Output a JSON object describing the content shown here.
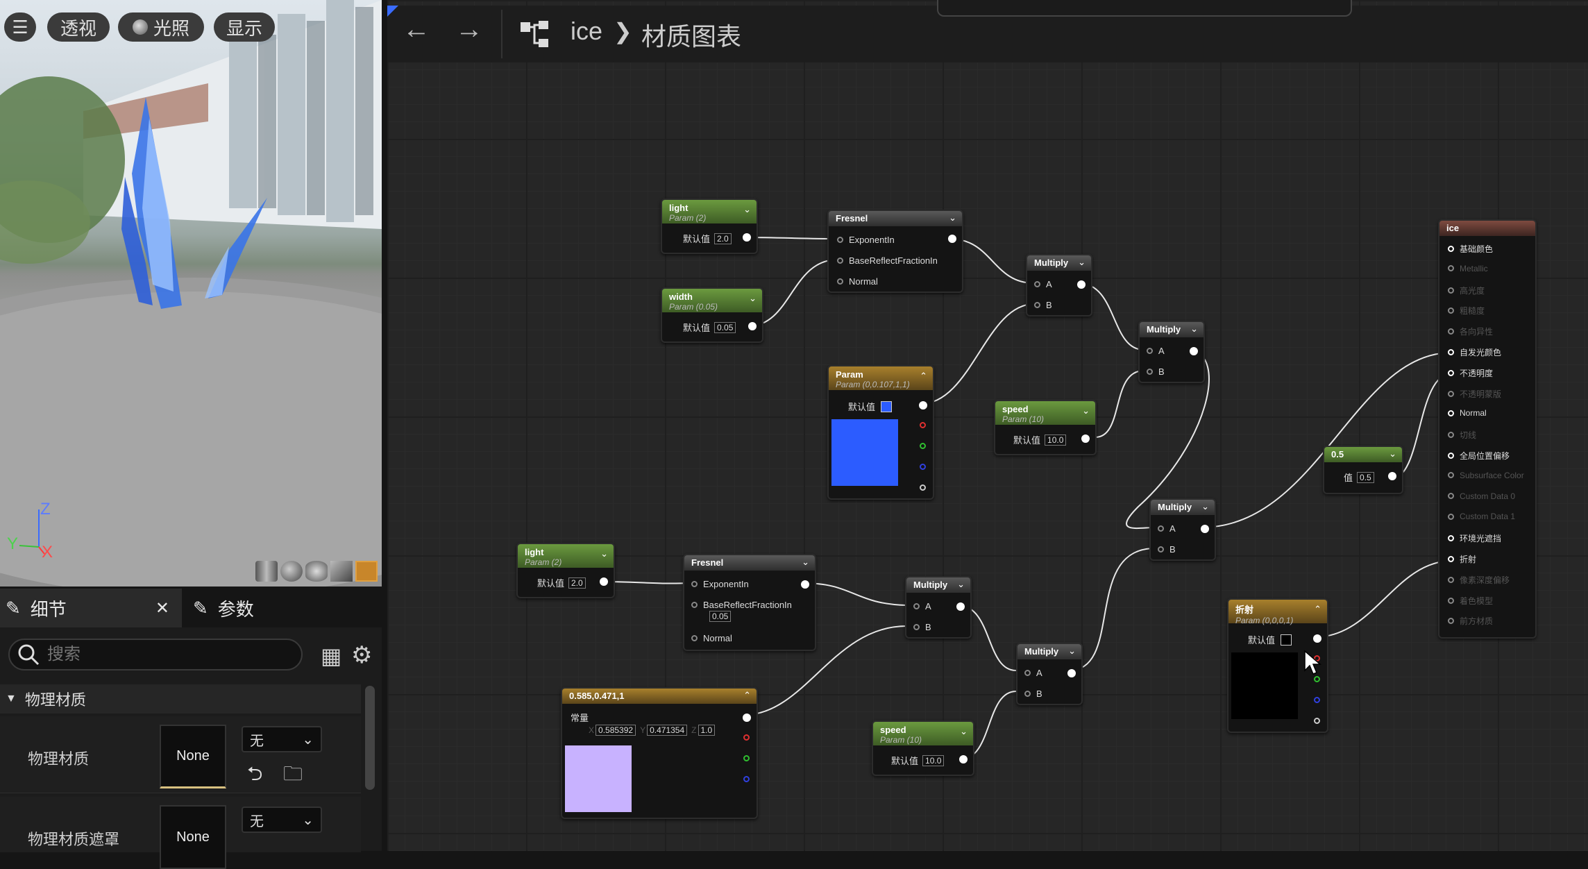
{
  "viewport": {
    "buttons": [
      "透视",
      "光照",
      "显示"
    ],
    "axes": {
      "z": "Z",
      "y": "Y",
      "x": "X"
    }
  },
  "toolbar": {
    "breadcrumb_asset": "ice",
    "breadcrumb_graph": "材质图表"
  },
  "panel": {
    "tab_details": "细节",
    "tab_params": "参数",
    "search_placeholder": "搜索",
    "section_title": "物理材质",
    "props": [
      {
        "label": "物理材质",
        "value": "None",
        "dropdown": "无"
      },
      {
        "label": "物理材质遮罩",
        "value": "None",
        "dropdown": "无"
      }
    ]
  },
  "nodes": {
    "light1": {
      "title": "light",
      "sub": "Param (2)",
      "label": "默认值",
      "value": "2.0"
    },
    "width": {
      "title": "width",
      "sub": "Param (0.05)",
      "label": "默认值",
      "value": "0.05"
    },
    "fresnel1": {
      "title": "Fresnel",
      "pins": [
        "ExponentIn",
        "BaseReflectFractionIn",
        "Normal"
      ]
    },
    "param_color": {
      "title": "Param",
      "sub": "Param (0,0.107,1,1)",
      "label": "默认值"
    },
    "multiply1": {
      "title": "Multiply",
      "a": "A",
      "b": "B"
    },
    "speed1": {
      "title": "speed",
      "sub": "Param (10)",
      "label": "默认值",
      "value": "10.0"
    },
    "multiply2": {
      "title": "Multiply",
      "a": "A",
      "b": "B"
    },
    "const05": {
      "title": "0.5",
      "label": "值",
      "value": "0.5"
    },
    "multiply3": {
      "title": "Multiply",
      "a": "A",
      "b": "B"
    },
    "light2": {
      "title": "light",
      "sub": "Param (2)",
      "label": "默认值",
      "value": "2.0"
    },
    "fresnel2": {
      "title": "Fresnel",
      "pins": [
        "ExponentIn",
        "BaseReflectFractionIn",
        "Normal"
      ],
      "brf_value": "0.05"
    },
    "multiply4": {
      "title": "Multiply",
      "a": "A",
      "b": "B"
    },
    "multiply5": {
      "title": "Multiply",
      "a": "A",
      "b": "B"
    },
    "const3": {
      "title": "0.585,0.471,1",
      "label": "常量",
      "x_label": "X",
      "x": "0.585392",
      "y_label": "Y",
      "y": "0.471354",
      "z_label": "Z",
      "z": "1.0"
    },
    "speed2": {
      "title": "speed",
      "sub": "Param (10)",
      "label": "默认值",
      "value": "10.0"
    },
    "refraction": {
      "title": "折射",
      "sub": "Param (0,0,0,1)",
      "label": "默认值"
    },
    "result": {
      "title": "ice",
      "pins": [
        {
          "label": "基础颜色",
          "active": true
        },
        {
          "label": "Metallic",
          "active": false
        },
        {
          "label": "高光度",
          "active": false
        },
        {
          "label": "粗糙度",
          "active": false
        },
        {
          "label": "各向异性",
          "active": false
        },
        {
          "label": "自发光颜色",
          "active": true
        },
        {
          "label": "不透明度",
          "active": true
        },
        {
          "label": "不透明蒙版",
          "active": false
        },
        {
          "label": "Normal",
          "active": true
        },
        {
          "label": "切线",
          "active": false
        },
        {
          "label": "全局位置偏移",
          "active": true
        },
        {
          "label": "Subsurface Color",
          "active": false
        },
        {
          "label": "Custom Data 0",
          "active": false
        },
        {
          "label": "Custom Data 1",
          "active": false
        },
        {
          "label": "环境光遮挡",
          "active": true
        },
        {
          "label": "折射",
          "active": true
        },
        {
          "label": "像素深度偏移",
          "active": false
        },
        {
          "label": "着色模型",
          "active": false
        },
        {
          "label": "前方材质",
          "active": false
        }
      ]
    }
  },
  "colors": {
    "param_swatch": "#2c5cff",
    "const_swatch": "#c8b2ff",
    "refraction_swatch": "#000000"
  }
}
